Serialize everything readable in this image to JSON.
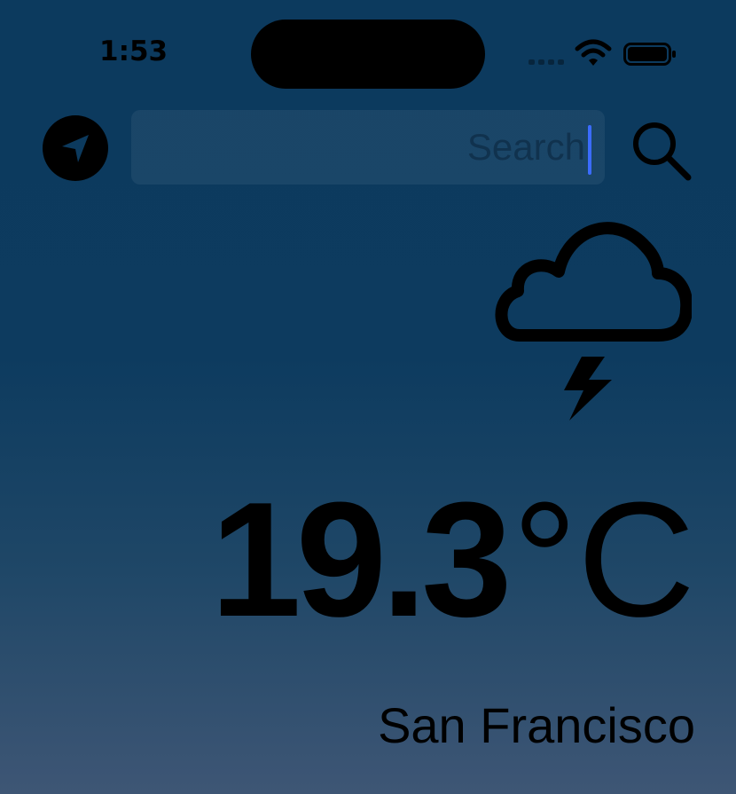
{
  "status_bar": {
    "time": "1:53",
    "icons": [
      "signal-icon",
      "wifi-icon",
      "battery-icon"
    ]
  },
  "header": {
    "location_icon": "location-arrow-icon",
    "search": {
      "placeholder": "Search",
      "value": ""
    },
    "search_icon": "magnifying-glass-icon"
  },
  "weather": {
    "condition_icon": "cloud-bolt-icon",
    "temperature_value": "19.3",
    "temperature_unit": "°C",
    "city": "San Francisco"
  },
  "colors": {
    "background_top": "#0c3a5e",
    "background_bottom": "#3e5675",
    "foreground": "#000000",
    "caret": "#3b6cff"
  }
}
